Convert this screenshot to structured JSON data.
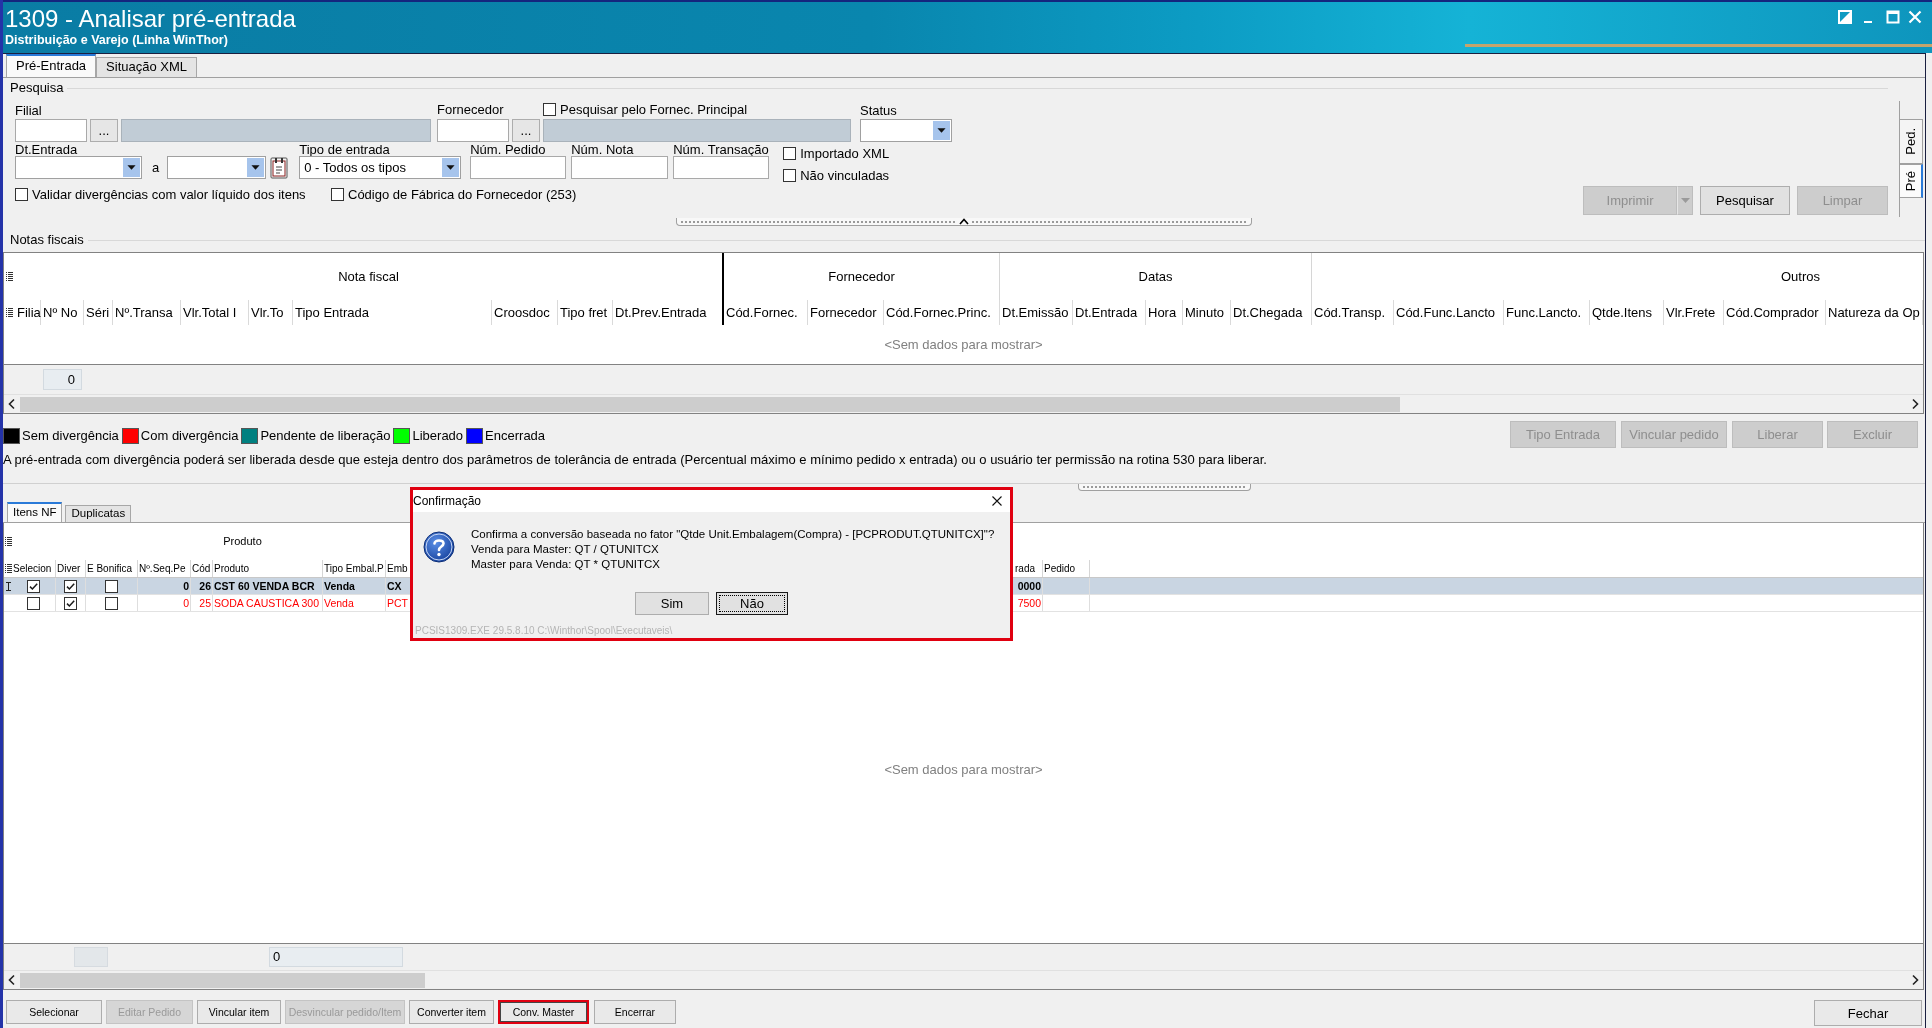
{
  "window": {
    "title": "1309 - Analisar pré-entrada",
    "subtitle": "Distribuição e Varejo (Linha WinThor)"
  },
  "tabs": [
    {
      "label": "Pré-Entrada",
      "selected": true
    },
    {
      "label": "Situação XML",
      "selected": false
    }
  ],
  "search": {
    "title": "Pesquisa",
    "filial": {
      "label": "Filial",
      "browse": "..."
    },
    "fornecedor": {
      "label": "Fornecedor",
      "browse": "...",
      "principal": {
        "label": "Pesquisar pelo Fornec. Principal",
        "checked": false
      }
    },
    "status": {
      "label": "Status"
    },
    "dt_entrada": {
      "label": "Dt.Entrada",
      "to": "a"
    },
    "tipo_entrada": {
      "label": "Tipo de entrada",
      "value": "0 - Todos os tipos"
    },
    "numbers": [
      {
        "label": "Núm. Pedido"
      },
      {
        "label": "Núm. Nota"
      },
      {
        "label": "Núm. Transação"
      }
    ],
    "filters": [
      {
        "label": "Importado XML",
        "checked": false
      },
      {
        "label": "Não vinculadas",
        "checked": false
      }
    ],
    "options": [
      {
        "label": "Validar divergências com valor líquido dos itens",
        "checked": false
      },
      {
        "label": "Código de Fábrica do Fornecedor (253)",
        "checked": false
      }
    ],
    "buttons": [
      {
        "label": "Imprimir",
        "disabled": true,
        "kind": "split"
      },
      {
        "label": "Pesquisar",
        "disabled": false,
        "kind": "plain"
      },
      {
        "label": "Limpar",
        "disabled": true,
        "kind": "plain"
      }
    ]
  },
  "side_tabs": [
    {
      "label": "Ped.",
      "selected": false
    },
    {
      "label": "Pré",
      "selected": true
    }
  ],
  "invoices": {
    "title": "Notas fiscais",
    "groups": [
      {
        "label": "Nota fiscal",
        "columns": [
          "Filia",
          "Nº No",
          "Séri",
          "Nº.Transa",
          "Vlr.Total I",
          "Vlr.To",
          "Tipo Entrada",
          "Croosdoc",
          "Tipo fret",
          "Dt.Prev.Entrada"
        ]
      },
      {
        "label": "Fornecedor",
        "columns": [
          "Cód.Fornec.",
          "Fornecedor",
          "Cód.Fornec.Princ."
        ]
      },
      {
        "label": "Datas",
        "columns": [
          "Dt.Emissão",
          "Dt.Entrada",
          "Hora",
          "Minuto",
          "Dt.Chegada"
        ]
      },
      {
        "label": "Outros",
        "columns": [
          "Cód.Transp.",
          "Cód.Func.Lancto",
          "Func.Lancto.",
          "Qtde.Itens",
          "Vlr.Frete",
          "Cód.Comprador",
          "Natureza da Op"
        ]
      }
    ],
    "empty_text": "<Sem dados para mostrar>",
    "count": "0"
  },
  "legend": [
    {
      "label": "Sem divergência",
      "color": "#000000"
    },
    {
      "label": "Com divergência",
      "color": "#ff0000"
    },
    {
      "label": "Pendente de liberação",
      "color": "#008080"
    },
    {
      "label": "Liberado",
      "color": "#00ff00"
    },
    {
      "label": "Encerrada",
      "color": "#0000ff"
    }
  ],
  "note": "A pré-entrada com divergência poderá ser liberada desde que esteja dentro dos parâmetros de tolerância de entrada (Percentual máximo e mínimo pedido x entrada) ou o usuário ter permissão na rotina 530 para liberar.",
  "actions": [
    {
      "label": "Tipo Entrada",
      "disabled": true
    },
    {
      "label": "Vincular pedido",
      "disabled": true
    },
    {
      "label": "Liberar",
      "disabled": true
    },
    {
      "label": "Excluir",
      "disabled": true
    }
  ],
  "item_tabs": [
    {
      "label": "Itens NF",
      "selected": true
    },
    {
      "label": "Duplicatas",
      "selected": false
    }
  ],
  "items": {
    "group": "Produto",
    "columns": [
      "Selecion",
      "Diver",
      "E Bonifica",
      "Nº.Seq.Pe",
      "Cód",
      "Produto",
      "Tipo Embal.P",
      "Emb",
      "rada",
      "Pedido"
    ],
    "rows": [
      {
        "selected": true,
        "color": "#000000",
        "cells": [
          {
            "kind": "check",
            "checked": true
          },
          {
            "kind": "check",
            "checked": true
          },
          {
            "kind": "check",
            "checked": false
          },
          {
            "kind": "text",
            "text": "0"
          },
          {
            "kind": "text",
            "text": "26"
          },
          {
            "kind": "text",
            "text": "CST 60 VENDA BCR"
          },
          {
            "kind": "text",
            "text": "Venda"
          },
          {
            "kind": "text",
            "text": "CX"
          },
          {
            "kind": "text",
            "text": "0000"
          }
        ]
      },
      {
        "selected": false,
        "color": "#ff0000",
        "cells": [
          {
            "kind": "check",
            "checked": false
          },
          {
            "kind": "check",
            "checked": true
          },
          {
            "kind": "check",
            "checked": false
          },
          {
            "kind": "text",
            "text": "0"
          },
          {
            "kind": "text",
            "text": "25"
          },
          {
            "kind": "text",
            "text": "SODA CAUSTICA 300"
          },
          {
            "kind": "text",
            "text": "Venda"
          },
          {
            "kind": "text",
            "text": "PCT"
          },
          {
            "kind": "text",
            "text": "7500"
          }
        ]
      }
    ],
    "empty_text": "<Sem dados para mostrar>",
    "count": "0"
  },
  "dialog": {
    "title": "Confirmação",
    "message": "Confirma a conversão baseada no fator \"Qtde Unit.Embalagem(Compra) - [PCPRODUT.QTUNITCX]\"?\nVenda para Master: QT / QTUNITCX\nMaster para Venda: QT * QTUNITCX",
    "buttons": [
      {
        "label": "Sim",
        "focused": false
      },
      {
        "label": "Não",
        "focused": true
      }
    ],
    "status": "PCSIS1309.EXE 29.5.8.10 C:\\Winthor\\Spool\\Executaveis\\",
    "highlighted": true
  },
  "toolbar": [
    {
      "label": "Selecionar",
      "disabled": false,
      "highlighted": false
    },
    {
      "label": "Editar Pedido",
      "disabled": true,
      "highlighted": false
    },
    {
      "label": "Vincular item",
      "disabled": false,
      "highlighted": false
    },
    {
      "label": "Desvincular pedido/Item",
      "disabled": true,
      "highlighted": false
    },
    {
      "label": "Converter item",
      "disabled": false,
      "highlighted": false
    },
    {
      "label": "Conv. Master",
      "disabled": false,
      "highlighted": true
    },
    {
      "label": "Encerrar",
      "disabled": false,
      "highlighted": false
    }
  ],
  "close_button": {
    "label": "Fechar"
  }
}
